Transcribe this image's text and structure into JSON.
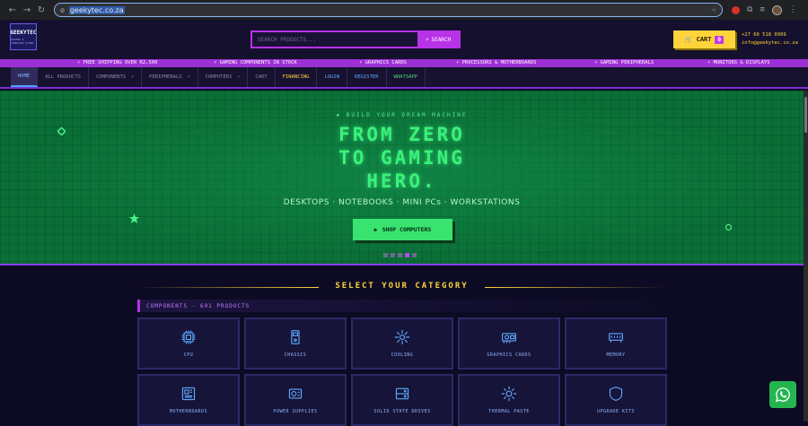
{
  "browser": {
    "url": "geekytec.co.za"
  },
  "header": {
    "logo_line1": "GEEKYTEC",
    "logo_line2": "GAMING & COMPUTER STORE",
    "search_placeholder": "SEARCH PRODUCTS...",
    "search_button": "SEARCH",
    "cart_label": "CART",
    "cart_count": "0",
    "phone": "+27 60 518 0999",
    "email": "info@geekytec.co.za"
  },
  "ticker": [
    "FREE SHIPPING OVER R2,500",
    "GAMING COMPONENTS IN STOCK",
    "GRAPHICS CARDS",
    "PROCESSORS & MOTHERBOARDS",
    "GAMING PERIPHERALS",
    "MONITORS & DISPLAYS"
  ],
  "nav": [
    {
      "label": "HOME",
      "style": "active",
      "dropdown": false
    },
    {
      "label": "ALL PRODUCTS",
      "style": "",
      "dropdown": false
    },
    {
      "label": "COMPONENTS",
      "style": "",
      "dropdown": true
    },
    {
      "label": "PERIPHERALS",
      "style": "",
      "dropdown": true
    },
    {
      "label": "COMPUTERS",
      "style": "",
      "dropdown": true
    },
    {
      "label": "CART",
      "style": "",
      "dropdown": false
    },
    {
      "label": "FINANCING",
      "style": "gold",
      "dropdown": false
    },
    {
      "label": "LOGIN",
      "style": "blue",
      "dropdown": false
    },
    {
      "label": "REGISTER",
      "style": "blue",
      "dropdown": false
    },
    {
      "label": "WHATSAPP",
      "style": "green",
      "dropdown": false
    }
  ],
  "hero": {
    "kicker": "BUILD YOUR DREAM MACHINE",
    "title_lines": [
      "FROM ZERO",
      "TO GAMING",
      "HERO."
    ],
    "subtitle": "DESKTOPS · NOTEBOOKS · MINI PCs · WORKSTATIONS",
    "cta": "SHOP COMPUTERS",
    "slide_count": 5,
    "active_slide": 4
  },
  "categories": {
    "title": "SELECT YOUR CATEGORY",
    "group_heading": "COMPONENTS - 691 PRODUCTS",
    "items": [
      {
        "label": "CPU",
        "icon": "cpu-icon"
      },
      {
        "label": "CHASSIS",
        "icon": "chassis-icon"
      },
      {
        "label": "COOLING",
        "icon": "cooling-icon"
      },
      {
        "label": "GRAPHICS CARDS",
        "icon": "gpu-icon"
      },
      {
        "label": "MEMORY",
        "icon": "memory-icon"
      },
      {
        "label": "MOTHERBOARDS",
        "icon": "motherboard-icon"
      },
      {
        "label": "POWER SUPPLIES",
        "icon": "power-supply-icon"
      },
      {
        "label": "SOLID STATE DRIVES",
        "icon": "ssd-icon"
      },
      {
        "label": "THERMAL PASTE",
        "icon": "thermal-paste-icon"
      },
      {
        "label": "UPGRADE KITS",
        "icon": "upgrade-kit-icon"
      }
    ]
  },
  "colors": {
    "accent": "#b832e8",
    "gold": "#ffd43b",
    "hero_green": "#39f27a",
    "whatsapp": "#25b54f"
  }
}
